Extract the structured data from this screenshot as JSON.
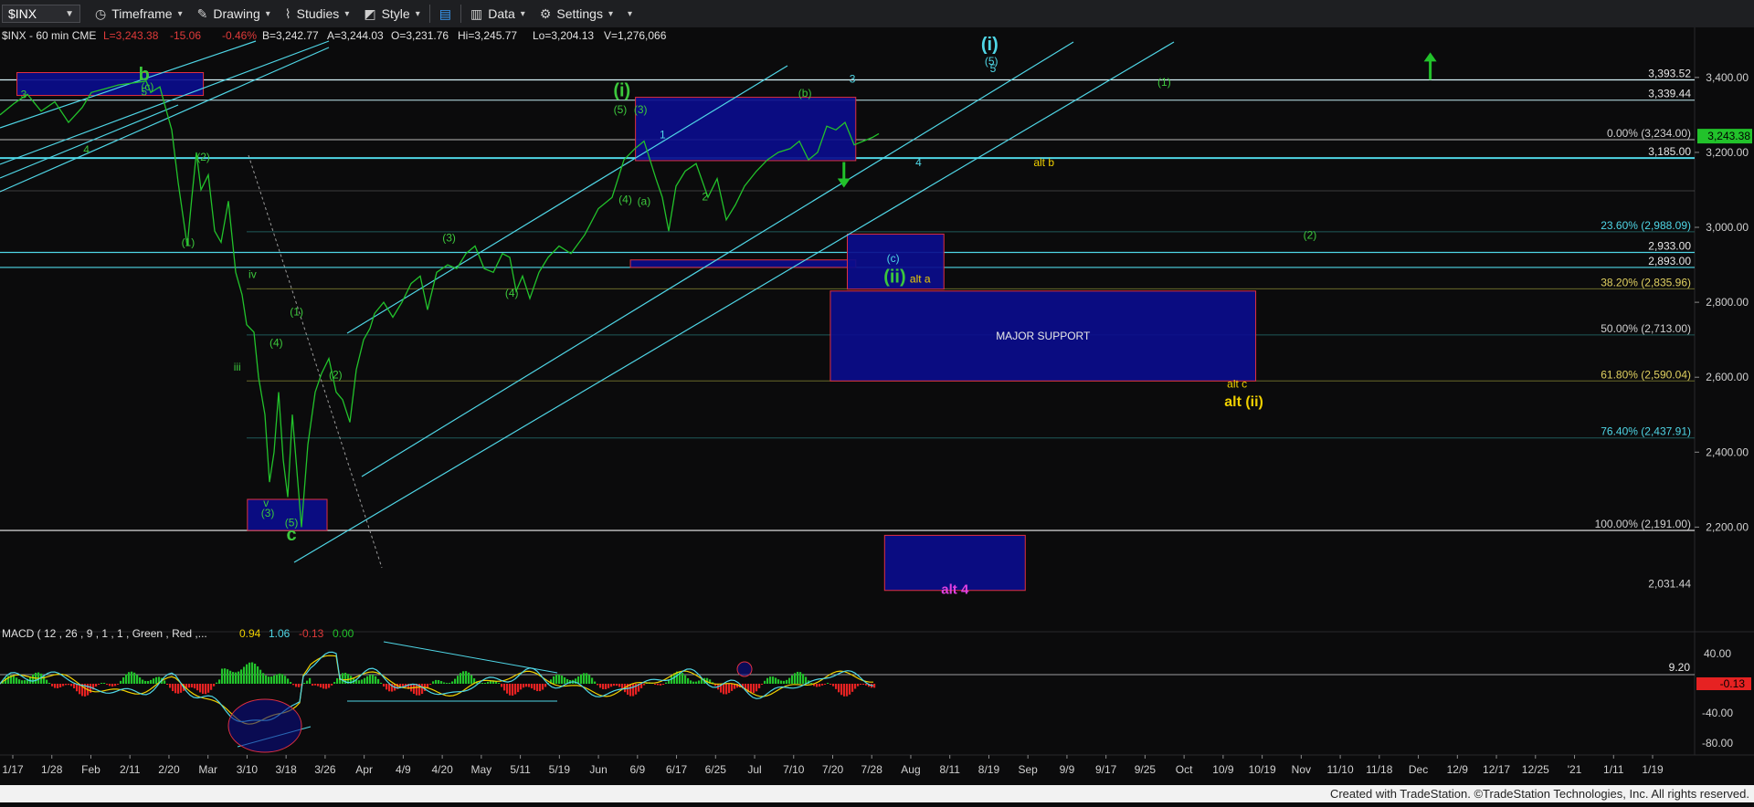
{
  "toolbar": {
    "symbol": "$INX",
    "timeframe": "Timeframe",
    "drawing": "Drawing",
    "studies": "Studies",
    "style": "Style",
    "data": "Data",
    "settings": "Settings"
  },
  "info_line": "$INX - 60 min CME",
  "quote": {
    "last": "L=3,243.38",
    "change": "-15.06",
    "pct": "-0.46%",
    "bid": "B=3,242.77",
    "ask": "A=3,244.03",
    "open": "O=3,231.76",
    "high": "Hi=3,245.77",
    "low": "Lo=3,204.13",
    "volume": "V=1,276,066"
  },
  "macd": {
    "title": "MACD ( 12 , 26 , 9 , 1 , 1 , Green , Red ,...",
    "v1": "0.94",
    "v2": "1.06",
    "v3": "-0.13",
    "v4": "0.00",
    "axis_ticks": [
      "40.00",
      "-40.00",
      "-80.00"
    ],
    "tag_920": "9.20",
    "tag_last": "-0.13"
  },
  "footer": "Created with TradeStation. ©TradeStation Technologies, Inc. All rights reserved.",
  "colors": {
    "background": "#0b0b0c",
    "price": "#22c22b",
    "wave_label": "#3cc73c",
    "cyan": "#4fd6e6",
    "yellow": "#f0d000",
    "box_fill": "#0b0d8c",
    "box_border": "#e03040",
    "macd_up": "#22c22b",
    "macd_down": "#e62222"
  },
  "chart_data": {
    "type": "line",
    "symbol": "$INX",
    "interval": "60 min",
    "ylim": [
      2031.44,
      3440
    ],
    "x_tick_labels": [
      "1/17",
      "1/28",
      "Feb",
      "2/11",
      "2/20",
      "Mar",
      "3/10",
      "3/18",
      "3/26",
      "Apr",
      "4/9",
      "4/20",
      "May",
      "5/11",
      "5/19",
      "Jun",
      "6/9",
      "6/17",
      "6/25",
      "Jul",
      "7/10",
      "7/20",
      "7/28",
      "Aug",
      "8/11",
      "8/19",
      "Sep",
      "9/9",
      "9/17",
      "9/25",
      "Oct",
      "10/9",
      "10/19",
      "Nov",
      "11/10",
      "11/18",
      "Dec",
      "12/9",
      "12/17",
      "12/25",
      "'21",
      "1/11",
      "1/19"
    ],
    "y_tick_labels": [
      "3,400.00",
      "3,200.00",
      "3,000.00",
      "2,800.00",
      "2,600.00",
      "2,400.00",
      "2,200.00"
    ],
    "y_tick_values": [
      3400,
      3200,
      3000,
      2800,
      2600,
      2400,
      2200
    ],
    "level_labels": [
      {
        "text": "3,393.52",
        "value": 3393.52
      },
      {
        "text": "3,339.44",
        "value": 3339.44
      },
      {
        "text": "0.00% (3,234.00)",
        "value": 3234.0
      },
      {
        "text": "3,185.00",
        "value": 3185.0
      },
      {
        "text": "23.60% (2,988.09)",
        "value": 2988.09
      },
      {
        "text": "2,933.00",
        "value": 2933.0
      },
      {
        "text": "2,893.00",
        "value": 2893.0
      },
      {
        "text": "38.20% (2,835.96)",
        "value": 2835.96
      },
      {
        "text": "50.00% (2,713.00)",
        "value": 2713.0
      },
      {
        "text": "61.80% (2,590.04)",
        "value": 2590.04
      },
      {
        "text": "76.40% (2,437.91)",
        "value": 2437.91
      },
      {
        "text": "100.00% (2,191.00)",
        "value": 2191.0
      },
      {
        "text": "2,031.44",
        "value": 2031.44
      }
    ],
    "last_price": {
      "text": "3,243.38",
      "value": 3243.38
    },
    "boxes": [
      {
        "label": "",
        "x0": 0.01,
        "x1": 0.12,
        "y0": 3413,
        "y1": 3352
      },
      {
        "label": "",
        "x0": 0.375,
        "x1": 0.505,
        "y0": 3347,
        "y1": 3178
      },
      {
        "label": "",
        "x0": 0.372,
        "x1": 0.505,
        "y0": 2913,
        "y1": 2893
      },
      {
        "label": "",
        "x0": 0.5,
        "x1": 0.557,
        "y0": 2982,
        "y1": 2835
      },
      {
        "label": "MAJOR SUPPORT",
        "x0": 0.49,
        "x1": 0.741,
        "y0": 2830,
        "y1": 2590
      },
      {
        "label": "",
        "x0": 0.146,
        "x1": 0.193,
        "y0": 2274,
        "y1": 2191
      },
      {
        "label": "alt 4",
        "x0": 0.522,
        "x1": 0.605,
        "y0": 2178,
        "y1": 2031
      }
    ],
    "wave_labels": [
      {
        "text": "b",
        "x": 0.085,
        "y": 3392,
        "color": "green",
        "size": "lg",
        "bold": true
      },
      {
        "text": "(c)",
        "x": 0.087,
        "y": 3365,
        "color": "green",
        "size": "sm"
      },
      {
        "text": "5",
        "x": 0.085,
        "y": 3352,
        "color": "green",
        "size": "sm"
      },
      {
        "text": "3",
        "x": 0.014,
        "y": 3345,
        "color": "green",
        "size": "sm"
      },
      {
        "text": "4",
        "x": 0.051,
        "y": 3197,
        "color": "green",
        "size": "sm"
      },
      {
        "text": "(2)",
        "x": 0.12,
        "y": 3178,
        "color": "green",
        "size": "sm"
      },
      {
        "text": "(1)",
        "x": 0.111,
        "y": 2950,
        "color": "green",
        "size": "sm"
      },
      {
        "text": "iv",
        "x": 0.149,
        "y": 2865,
        "color": "green",
        "size": "sm"
      },
      {
        "text": "iii",
        "x": 0.14,
        "y": 2617,
        "color": "green",
        "size": "sm"
      },
      {
        "text": "(4)",
        "x": 0.163,
        "y": 2682,
        "color": "green",
        "size": "sm"
      },
      {
        "text": "(1)",
        "x": 0.175,
        "y": 2765,
        "color": "green",
        "size": "sm"
      },
      {
        "text": "(2)",
        "x": 0.198,
        "y": 2597,
        "color": "green",
        "size": "sm"
      },
      {
        "text": "v",
        "x": 0.157,
        "y": 2255,
        "color": "green",
        "size": "sm"
      },
      {
        "text": "(3)",
        "x": 0.158,
        "y": 2228,
        "color": "green",
        "size": "sm"
      },
      {
        "text": "(5)",
        "x": 0.172,
        "y": 2202,
        "color": "green",
        "size": "sm"
      },
      {
        "text": "c",
        "x": 0.172,
        "y": 2165,
        "color": "green",
        "size": "lg",
        "bold": true
      },
      {
        "text": "(3)",
        "x": 0.265,
        "y": 2962,
        "color": "green",
        "size": "sm"
      },
      {
        "text": "(4)",
        "x": 0.302,
        "y": 2815,
        "color": "green",
        "size": "sm"
      },
      {
        "text": "(i)",
        "x": 0.367,
        "y": 3350,
        "color": "green",
        "size": "lg",
        "bold": true
      },
      {
        "text": "(5)",
        "x": 0.366,
        "y": 3305,
        "color": "green",
        "size": "sm"
      },
      {
        "text": "(3)",
        "x": 0.378,
        "y": 3305,
        "color": "green",
        "size": "sm"
      },
      {
        "text": "1",
        "x": 0.391,
        "y": 3237,
        "color": "cyan",
        "size": "sm"
      },
      {
        "text": "(4)",
        "x": 0.369,
        "y": 3065,
        "color": "green",
        "size": "sm"
      },
      {
        "text": "(a)",
        "x": 0.38,
        "y": 3060,
        "color": "green",
        "size": "sm"
      },
      {
        "text": "2",
        "x": 0.416,
        "y": 3072,
        "color": "green",
        "size": "sm"
      },
      {
        "text": "(b)",
        "x": 0.475,
        "y": 3348,
        "color": "green",
        "size": "sm"
      },
      {
        "text": "3",
        "x": 0.503,
        "y": 3386,
        "color": "cyan",
        "size": "sm"
      },
      {
        "text": "4",
        "x": 0.542,
        "y": 3163,
        "color": "cyan",
        "size": "sm"
      },
      {
        "text": "(c)",
        "x": 0.527,
        "y": 2908,
        "color": "cyan",
        "size": "sm"
      },
      {
        "text": "(ii)",
        "x": 0.528,
        "y": 2853,
        "color": "green",
        "size": "lg",
        "bold": true
      },
      {
        "text": "alt a",
        "x": 0.543,
        "y": 2853,
        "color": "yellow",
        "size": "sm"
      },
      {
        "text": "alt b",
        "x": 0.616,
        "y": 3163,
        "color": "yellow",
        "size": "sm"
      },
      {
        "text": "alt c",
        "x": 0.73,
        "y": 2572,
        "color": "yellow",
        "size": "sm"
      },
      {
        "text": "alt (ii)",
        "x": 0.734,
        "y": 2523,
        "color": "yellow",
        "size": "md",
        "bold": true
      },
      {
        "text": "(i)",
        "x": 0.584,
        "y": 3473,
        "color": "cyan",
        "size": "lg",
        "bold": true
      },
      {
        "text": "(5)",
        "x": 0.585,
        "y": 3434,
        "color": "cyan",
        "size": "sm"
      },
      {
        "text": "5",
        "x": 0.586,
        "y": 3414,
        "color": "cyan",
        "size": "sm"
      },
      {
        "text": "(1)",
        "x": 0.687,
        "y": 3378,
        "color": "green",
        "size": "sm"
      },
      {
        "text": "(2)",
        "x": 0.773,
        "y": 2969,
        "color": "green",
        "size": "sm"
      }
    ],
    "arrows": [
      {
        "direction": "up",
        "x": 0.844,
        "y": 3428
      },
      {
        "direction": "down",
        "x": 0.498,
        "y": 3140
      }
    ]
  }
}
